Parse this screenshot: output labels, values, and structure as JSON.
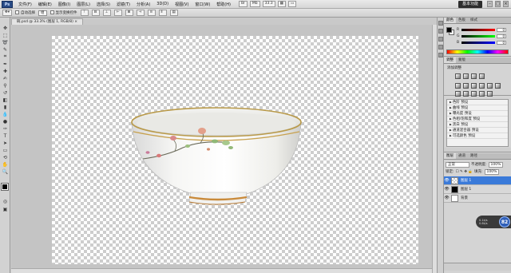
{
  "app": {
    "logo": "Ps",
    "menu": [
      "文件(F)",
      "编辑(E)",
      "图像(I)",
      "图层(L)",
      "选择(S)",
      "滤镜(T)",
      "分析(A)",
      "3D(D)",
      "视图(V)",
      "窗口(W)",
      "帮助(H)"
    ],
    "zoom": "33.3",
    "workspace": "基本功能",
    "window_buttons": [
      "–",
      "□",
      "×"
    ]
  },
  "options": {
    "auto_select_label": "自动选择",
    "auto_select_target": "组",
    "show_transform_label": "显示变换控件"
  },
  "document": {
    "tab_title": "碗.psd @ 33.3% (图层 1, RGB/8) ×"
  },
  "color_panel": {
    "tabs": [
      "颜色",
      "色板",
      "样式"
    ],
    "channels": [
      {
        "label": "R",
        "value": "0"
      },
      {
        "label": "G",
        "value": "0"
      },
      {
        "label": "B",
        "value": "0"
      }
    ]
  },
  "adjustments": {
    "tabs": [
      "调整",
      "蒙版"
    ],
    "title": "添加调整",
    "presets": [
      "色阶 预设",
      "曲线 预设",
      "曝光度 预设",
      "色相/饱和度 预设",
      "黑白 预设",
      "通道混合器 预设",
      "可选颜色 预设"
    ]
  },
  "layers": {
    "tabs": [
      "图层",
      "通道",
      "路径"
    ],
    "blend_mode": "正常",
    "opacity_label": "不透明度:",
    "opacity": "100%",
    "lock_label": "锁定:",
    "fill_label": "填充:",
    "fill": "100%",
    "items": [
      {
        "name": "图层 1",
        "selected": true
      },
      {
        "name": "图层 1",
        "selected": false
      },
      {
        "name": "背景",
        "selected": false
      }
    ]
  },
  "badge": {
    "up": "0.1k/s",
    "down": "0.6k/s",
    "percent": "82"
  }
}
